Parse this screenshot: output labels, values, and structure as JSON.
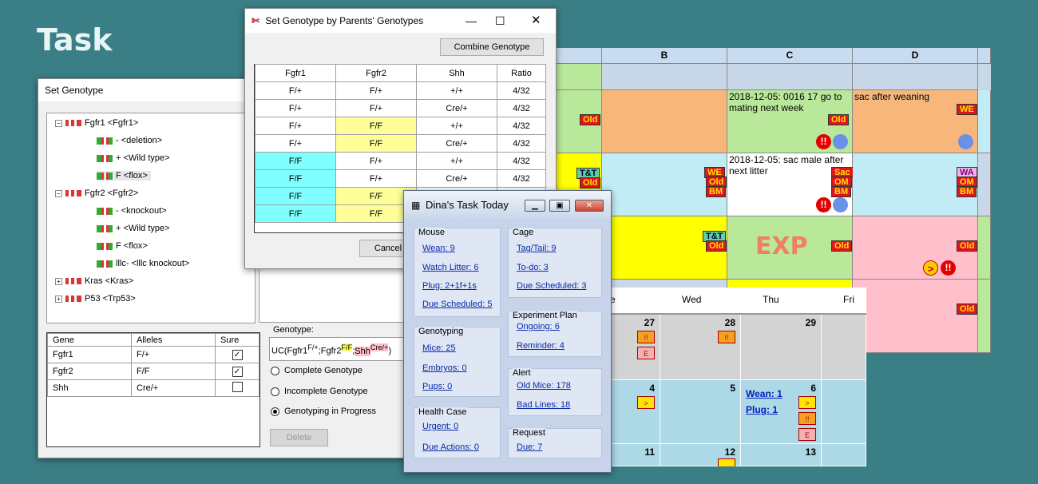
{
  "heading": "Task",
  "spreadsheet": {
    "columns": [
      "B",
      "C",
      "D"
    ],
    "notes": {
      "c_row1": "2018-12-05: 0016 17 go to mating next week",
      "d_row1": "sac after weaning",
      "c_row2": "2018-12-05: sac male after next litter",
      "exp": "EXP"
    },
    "badges": {
      "old": "Old",
      "we": "WE",
      "tt": "T&T",
      "sac": "Sac",
      "om": "OM",
      "bm": "BM",
      "wa": "WA"
    },
    "warning_glyph": "!!",
    "play_glyph": ">"
  },
  "week_calendar": {
    "days": [
      "e",
      "Wed",
      "Thu",
      "Fri"
    ],
    "dates": [
      "27",
      "28",
      "29",
      "4",
      "5",
      "6",
      "11",
      "12",
      "13"
    ],
    "mini": {
      "warn": "!!",
      "e": "E",
      "next": ">"
    },
    "links": {
      "wean": "Wean: 1",
      "plug": "Plug: 1"
    }
  },
  "set_genotype": {
    "title": "Set Genotype",
    "tree": [
      {
        "label": "Fgfr1 <Fgfr1>",
        "type": "gene"
      },
      {
        "label": "-  <deletion>",
        "type": "allele"
      },
      {
        "label": "+  <Wild type>",
        "type": "allele"
      },
      {
        "label": "F  <flox>",
        "type": "allele"
      },
      {
        "label": "Fgfr2 <Fgfr2>",
        "type": "gene"
      },
      {
        "label": "-  <knockout>",
        "type": "allele"
      },
      {
        "label": "+  <Wild type>",
        "type": "allele"
      },
      {
        "label": "F  <flox>",
        "type": "allele"
      },
      {
        "label": "lllc-  <lllc knockout>",
        "type": "allele"
      },
      {
        "label": "Kras <Kras>",
        "type": "gene"
      },
      {
        "label": "P53 <Trp53>",
        "type": "gene"
      }
    ],
    "table_headers": [
      "Gene",
      "Alleles",
      "Sure"
    ],
    "table_rows": [
      {
        "gene": "Fgfr1",
        "alleles": "F/+",
        "sure": "✓"
      },
      {
        "gene": "Fgfr2",
        "alleles": "F/F",
        "sure": "✓"
      },
      {
        "gene": "Shh",
        "alleles": "Cre/+",
        "sure": ""
      }
    ],
    "genotype_label": "Genotype:",
    "genotype_parts": [
      "UC(Fgfr1",
      "F/+",
      ";Fgfr2",
      "F/F",
      ";",
      "Shh",
      "Cre/+",
      ")"
    ],
    "radios": [
      "Complete Genotype",
      "Incomplete Genotype",
      "Genotyping in Progress"
    ],
    "selected_radio": "Genotyping in Progress",
    "delete_label": "Delete"
  },
  "parents_window": {
    "title": "Set Genotype by Parents' Genotypes",
    "combine_label": "Combine Genotype",
    "cancel_label": "Cancel",
    "headers": [
      "Fgfr1",
      "Fgfr2",
      "Shh",
      "Ratio"
    ],
    "rows": [
      [
        "F/+",
        "F/+",
        "+/+",
        "4/32"
      ],
      [
        "F/+",
        "F/+",
        "Cre/+",
        "4/32"
      ],
      [
        "F/+",
        "F/F",
        "+/+",
        "4/32"
      ],
      [
        "F/+",
        "F/F",
        "Cre/+",
        "4/32"
      ],
      [
        "F/F",
        "F/+",
        "+/+",
        "4/32"
      ],
      [
        "F/F",
        "F/+",
        "Cre/+",
        "4/32"
      ],
      [
        "F/F",
        "F/F",
        "",
        ""
      ],
      [
        "F/F",
        "F/F",
        "",
        ""
      ]
    ]
  },
  "task_today": {
    "title": "Dina's Task Today",
    "groups": {
      "mouse": {
        "title": "Mouse",
        "items": [
          "Wean: 9",
          "Watch Litter: 6",
          "Plug: 2+1f+1s",
          "Due Scheduled: 5"
        ]
      },
      "genotyping": {
        "title": "Genotyping",
        "items": [
          "Mice: 25",
          "Embryos: 0",
          "Pups: 0"
        ]
      },
      "health": {
        "title": "Health Case",
        "items": [
          "Urgent: 0",
          "Due Actions: 0"
        ]
      },
      "cage": {
        "title": "Cage",
        "items": [
          "Tag/Tail: 9",
          "To-do: 3",
          "Due Scheduled: 3"
        ]
      },
      "experiment": {
        "title": "Experiment Plan",
        "items": [
          "Ongoing: 6",
          "Reminder: 4"
        ]
      },
      "alert": {
        "title": "Alert",
        "items": [
          "Old Mice: 178",
          "Bad Lines: 18"
        ]
      },
      "request": {
        "title": "Request",
        "items": [
          "Due: 7"
        ]
      }
    }
  }
}
